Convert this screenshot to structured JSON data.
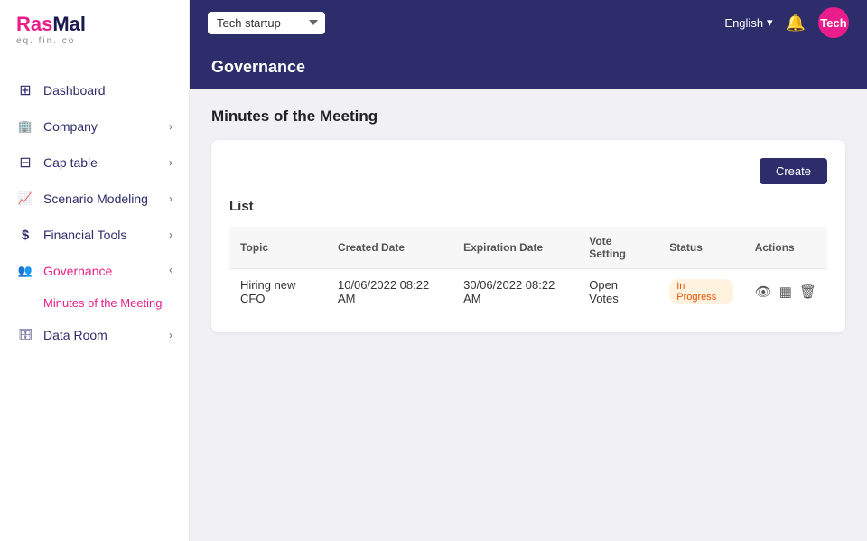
{
  "logo": {
    "brand": "RasMal",
    "sub": "eq. fin. co"
  },
  "sidebar": {
    "items": [
      {
        "id": "dashboard",
        "label": "Dashboard",
        "icon": "dashboard-icon",
        "hasArrow": false,
        "active": false
      },
      {
        "id": "company",
        "label": "Company",
        "icon": "company-icon",
        "hasArrow": true,
        "active": false
      },
      {
        "id": "captable",
        "label": "Cap table",
        "icon": "captable-icon",
        "hasArrow": true,
        "active": false
      },
      {
        "id": "scenario",
        "label": "Scenario Modeling",
        "icon": "scenario-icon",
        "hasArrow": true,
        "active": false
      },
      {
        "id": "financial",
        "label": "Financial Tools",
        "icon": "financial-icon",
        "hasArrow": true,
        "active": false
      },
      {
        "id": "governance",
        "label": "Governance",
        "icon": "governance-icon",
        "hasArrow": true,
        "active": true
      },
      {
        "id": "dataroom",
        "label": "Data Room",
        "icon": "dataroom-icon",
        "hasArrow": true,
        "active": false
      }
    ],
    "sub_items": [
      {
        "id": "minutes",
        "label": "Minutes of the Meeting",
        "active": true
      }
    ]
  },
  "topbar": {
    "workspace": "Tech startup",
    "language": "English",
    "user_initials": "Tech"
  },
  "page": {
    "title": "Governance",
    "section_title": "Minutes of the Meeting"
  },
  "table": {
    "create_label": "Create",
    "list_label": "List",
    "columns": [
      "Topic",
      "Created Date",
      "Expiration Date",
      "Vote Setting",
      "Status",
      "Actions"
    ],
    "rows": [
      {
        "topic": "Hiring new CFO",
        "created_date": "10/06/2022 08:22 AM",
        "expiration_date": "30/06/2022 08:22 AM",
        "vote_setting": "Open Votes",
        "status": "In Progress"
      }
    ]
  }
}
